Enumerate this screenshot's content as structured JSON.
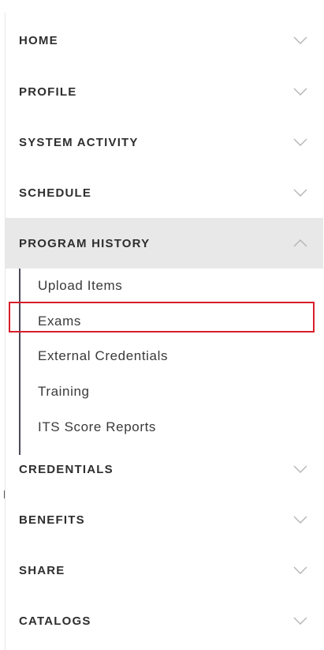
{
  "nav": {
    "items": [
      {
        "label": "HOME"
      },
      {
        "label": "PROFILE"
      },
      {
        "label": "SYSTEM ACTIVITY"
      },
      {
        "label": "SCHEDULE"
      },
      {
        "label": "PROGRAM HISTORY",
        "expanded": true
      },
      {
        "label": "CREDENTIALS"
      },
      {
        "label": "BENEFITS"
      },
      {
        "label": "SHARE"
      },
      {
        "label": "CATALOGS"
      }
    ],
    "program_history": {
      "sub_items": [
        {
          "label": "Upload Items"
        },
        {
          "label": "Exams",
          "highlighted": true
        },
        {
          "label": "External Credentials"
        },
        {
          "label": "Training"
        },
        {
          "label": "ITS Score Reports"
        }
      ]
    }
  },
  "colors": {
    "active_background": "#e8e8e8",
    "highlight_border": "#d81e2a",
    "text": "#2e2e2e",
    "chevron": "#b5b5b5"
  }
}
